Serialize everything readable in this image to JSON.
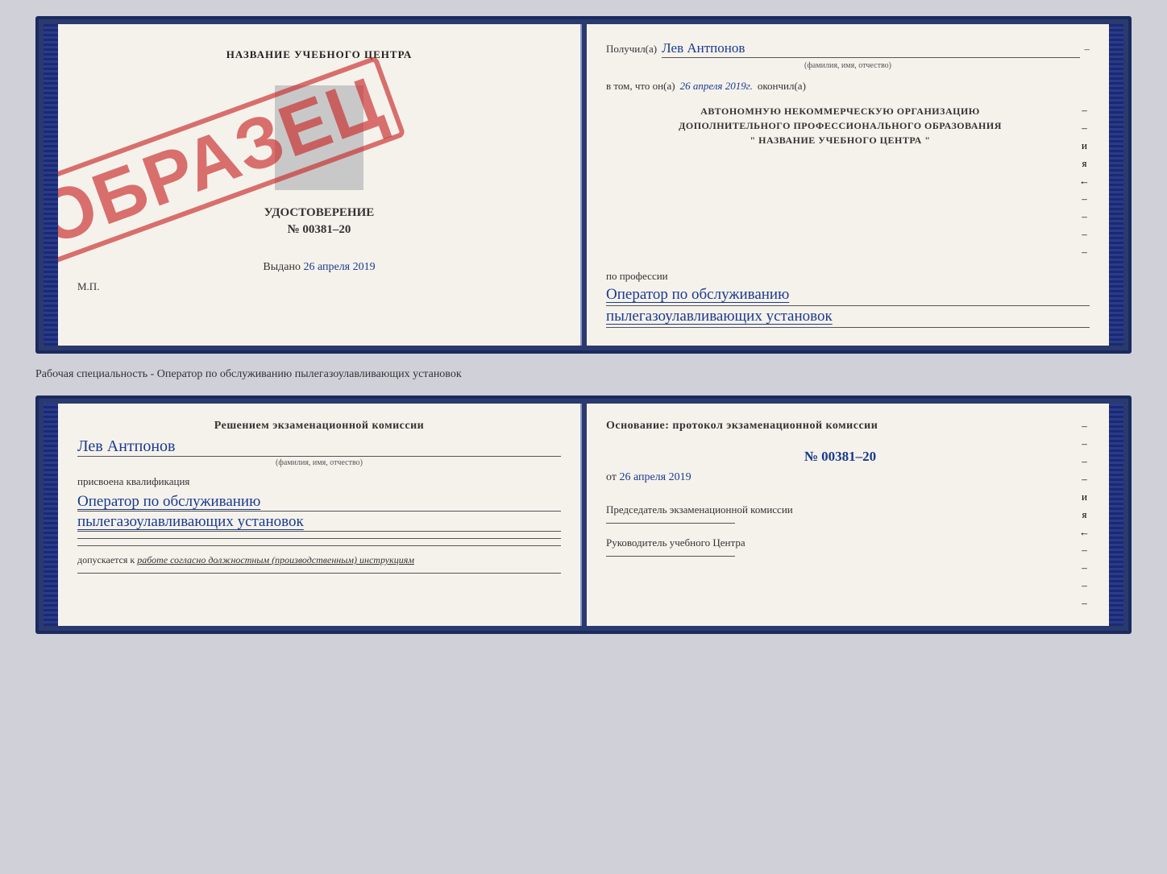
{
  "page": {
    "bg_color": "#d0d0d8"
  },
  "upper_book": {
    "left_page": {
      "training_center": "НАЗВАНИЕ УЧЕБНОГО ЦЕНТРА",
      "cert_label": "УДОСТОВЕРЕНИЕ",
      "cert_number": "№ 00381–20",
      "issue_date_label": "Выдано",
      "issue_date": "26 апреля 2019",
      "mp_label": "М.П.",
      "stamp_text": "ОБРАЗЕЦ"
    },
    "right_page": {
      "recipient_prefix": "Получил(а)",
      "recipient_name": "Лев Антпонов",
      "fio_subtitle": "(фамилия, имя, отчество)",
      "in_that_prefix": "в том, что он(а)",
      "completion_date": "26 апреля 2019г.",
      "finished_label": "окончил(а)",
      "org_line1": "АВТОНОМНУЮ НЕКОММЕРЧЕСКУЮ ОРГАНИЗАЦИЮ",
      "org_line2": "ДОПОЛНИТЕЛЬНОГО ПРОФЕССИОНАЛЬНОГО ОБРАЗОВАНИЯ",
      "org_line3": "\" НАЗВАНИЕ УЧЕБНОГО ЦЕНТРА \"",
      "profession_label": "по профессии",
      "profession_line1": "Оператор по обслуживанию",
      "profession_line2": "пылегазоулавливающих установок"
    }
  },
  "specialty_label": "Рабочая специальность - Оператор по обслуживанию пылегазоулавливающих установок",
  "lower_book": {
    "left_page": {
      "decision_label": "Решением экзаменационной комиссии",
      "person_name": "Лев Антпонов",
      "fio_subtitle": "(фамилия, имя, отчество)",
      "assigned_label": "присвоена квалификация",
      "qual_line1": "Оператор по обслуживанию",
      "qual_line2": "пылегазоулавливающих установок",
      "допускается_prefix": "допускается к",
      "допускается_text": "работе согласно должностным (производственным) инструкциям"
    },
    "right_page": {
      "basis_label": "Основание: протокол экзаменационной комиссии",
      "protocol_number": "№ 00381–20",
      "date_prefix": "от",
      "protocol_date": "26 апреля 2019",
      "chairman_label": "Председатель экзаменационной комиссии",
      "director_label": "Руководитель учебного Центра"
    }
  },
  "side_chars": {
    "dash": "–",
    "and": "и",
    "ya": "я",
    "arrow": "←"
  }
}
